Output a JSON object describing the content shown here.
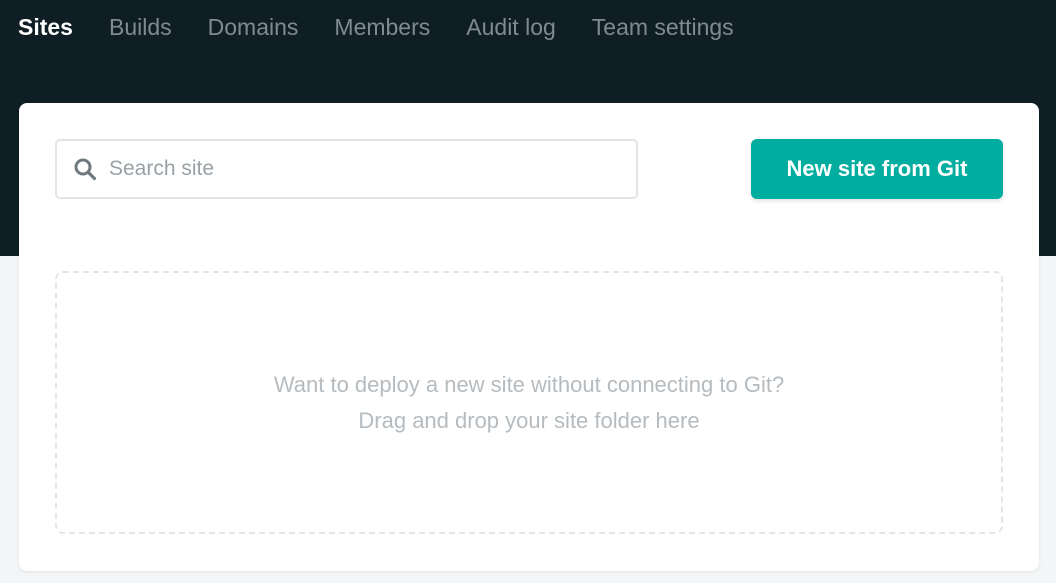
{
  "nav": {
    "tabs": [
      {
        "label": "Sites",
        "active": true
      },
      {
        "label": "Builds",
        "active": false
      },
      {
        "label": "Domains",
        "active": false
      },
      {
        "label": "Members",
        "active": false
      },
      {
        "label": "Audit log",
        "active": false
      },
      {
        "label": "Team settings",
        "active": false
      }
    ]
  },
  "search": {
    "placeholder": "Search site",
    "value": "",
    "icon": "search-icon"
  },
  "actions": {
    "new_site_label": "New site from Git"
  },
  "dropzone": {
    "line1": "Want to deploy a new site without connecting to Git?",
    "line2": "Drag and drop your site folder here"
  },
  "colors": {
    "header_bg": "#0f1e25",
    "page_bg": "#f3f5f7",
    "accent": "#00ad9f",
    "tab_inactive": "#808b91",
    "tab_active": "#ffffff"
  }
}
